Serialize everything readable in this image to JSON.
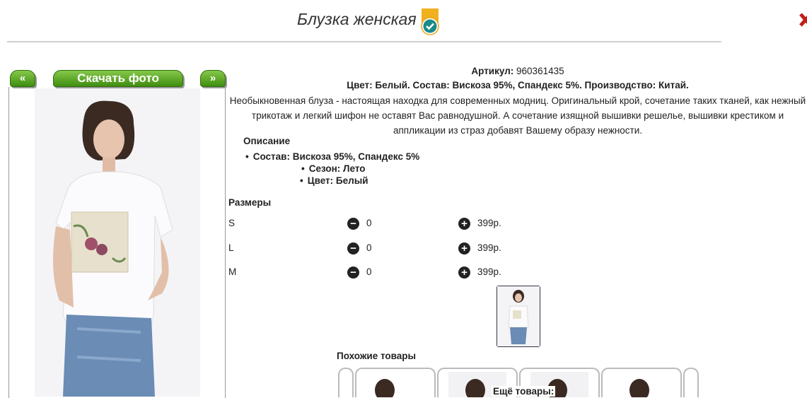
{
  "header": {
    "title": "Блузка женская",
    "verified_icon": "verified-badge-icon"
  },
  "gallery": {
    "prev_label": "«",
    "download_label": "Скачать фото",
    "next_label": "»"
  },
  "product": {
    "article_label": "Артикул:",
    "article_value": "960361435",
    "color_line": "Цвет: Белый. Состав: Вискоза 95%, Спандекс 5%. Производство: Китай.",
    "description": "Необыкновенная блуза - настоящая находка для современных модниц. Оригинальный крой, сочетание таких тканей, как нежный трикотаж и легкий шифон не оставят Вас равнодушной. А сочетание изящной вышивки решелье, вышивки крестиком и аппликации из страз добавят Вашему образу нежности.",
    "description_heading": "Описание",
    "bullets": [
      "Состав: Вискоза 95%, Спандекс 5%",
      "Сезон: Лето",
      "Цвет: Белый"
    ]
  },
  "sizes": {
    "heading": "Размеры",
    "rows": [
      {
        "name": "S",
        "qty": "0",
        "price": "399р."
      },
      {
        "name": "L",
        "qty": "0",
        "price": "399р."
      },
      {
        "name": "M",
        "qty": "0",
        "price": "399р."
      }
    ]
  },
  "similar": {
    "heading": "Похожие товары",
    "more_label": "Ещё товары:"
  },
  "colors": {
    "accent_green": "#4a9a1a",
    "badge_gold": "#f0b020",
    "badge_teal": "#1a8a8a"
  }
}
